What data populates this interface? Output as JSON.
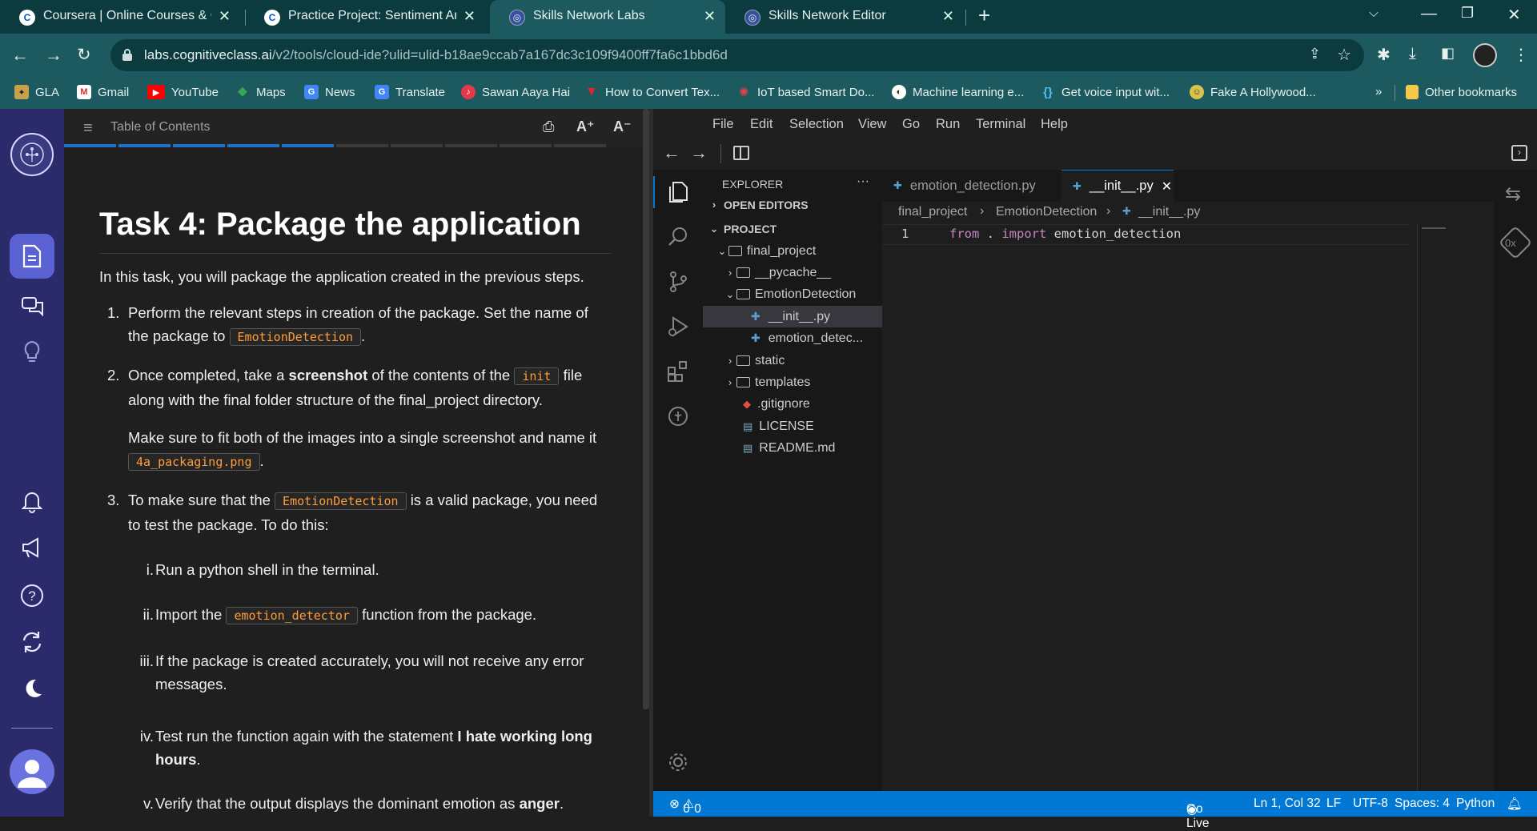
{
  "browser": {
    "tabs": [
      {
        "title": "Coursera | Online Courses & Credentials",
        "icon": "coursera-c-icon"
      },
      {
        "title": "Practice Project: Sentiment Analysis",
        "icon": "coursera-c-icon"
      },
      {
        "title": "Skills Network Labs",
        "icon": "skills-network-icon"
      },
      {
        "title": "Skills Network Editor",
        "icon": "skills-network-icon"
      }
    ],
    "url_host": "labs.cognitiveclass.ai",
    "url_path": "/v2/tools/cloud-ide?ulid=ulid-b18ae9ccab7a167dc3c109f9400ff7fa6c1bbd6d",
    "bookmarks": [
      "GLA",
      "Gmail",
      "YouTube",
      "Maps",
      "News",
      "Translate",
      "Sawan Aaya Hai",
      "How to Convert Tex...",
      "IoT based Smart Do...",
      "Machine learning e...",
      "Get voice input wit...",
      "Fake A Hollywood..."
    ],
    "overflow": "»",
    "other_bookmarks": "Other bookmarks"
  },
  "instructions": {
    "toc_label": "Table of Contents",
    "font_up": "A⁺",
    "font_down": "A⁻",
    "title": "Task 4: Package the application",
    "intro": "In this task, you will package the application created in the previous steps.",
    "step1_num": "1.",
    "step1_a": "Perform the relevant steps in creation of the package. Set the name of the package to",
    "step1_code": "EmotionDetection",
    "step1_b": ".",
    "step2_num": "2.",
    "step2_a": "Once completed, take a",
    "step2_bold": "screenshot",
    "step2_b": "of the contents of the",
    "step2_code": "init",
    "step2_c": "file along with the final folder structure of the final_project directory.",
    "step2_p2a": "Make sure to fit both of the images into a single screenshot and name it",
    "step2_code2": "4a_packaging.png",
    "step2_p2b": ".",
    "step3_num": "3.",
    "step3_a": "To make sure that the",
    "step3_code": "EmotionDetection",
    "step3_b": "is a valid package, you need to test the package. To do this:",
    "sub1_num": "i.",
    "sub1": "Run a python shell in the terminal.",
    "sub2_num": "ii.",
    "sub2_a": "Import the",
    "sub2_code": "emotion_detector",
    "sub2_b": "function from the package.",
    "sub3_num": "iii.",
    "sub3": "If the package is created accurately, you will not receive any error messages.",
    "sub4_num": "iv.",
    "sub4_a": "Test run the function again with the statement",
    "sub4_bold": "I hate working long hours",
    "sub4_b": ".",
    "sub5_num": "v.",
    "sub5_a": "Verify that the output displays the dominant emotion as",
    "sub5_bold": "anger",
    "sub5_b": ".",
    "progress_segments": 10,
    "progress_done": 5
  },
  "vscode": {
    "menu": [
      "File",
      "Edit",
      "Selection",
      "View",
      "Go",
      "Run",
      "Terminal",
      "Help"
    ],
    "explorer_title": "EXPLORER",
    "explorer_more": "···",
    "open_editors": "OPEN EDITORS",
    "project": "PROJECT",
    "tree": {
      "final_project": "final_project",
      "pycache": "__pycache__",
      "emotiondetection": "EmotionDetection",
      "init": "__init__.py",
      "emotion_file": "emotion_detec...",
      "static": "static",
      "templates": "templates",
      "gitignore": ".gitignore",
      "license": "LICENSE",
      "readme": "README.md"
    },
    "tabs": [
      {
        "label": "emotion_detection.py",
        "active": false
      },
      {
        "label": "__init__.py",
        "active": true
      }
    ],
    "breadcrumb": [
      "final_project",
      "EmotionDetection",
      "__init__.py"
    ],
    "code": {
      "line_no": "1",
      "kw1": "from",
      "dot": " . ",
      "kw2": "import",
      "ident": " emotion_detection"
    },
    "status": {
      "errors": "0",
      "warnings": "0",
      "golive": "Go Live",
      "position": "Ln 1, Col 32",
      "eol": "LF",
      "encoding": "UTF-8",
      "spaces": "Spaces: 4",
      "language": "Python"
    }
  },
  "colors": {
    "chrome_dark": "#0b3b3f",
    "chrome": "#1c5a5f",
    "coursera_rail": "#2b2b6b",
    "progress": "#1a73c8",
    "code_highlight": "#ff9d3b",
    "vscode_status": "#0078d4"
  }
}
